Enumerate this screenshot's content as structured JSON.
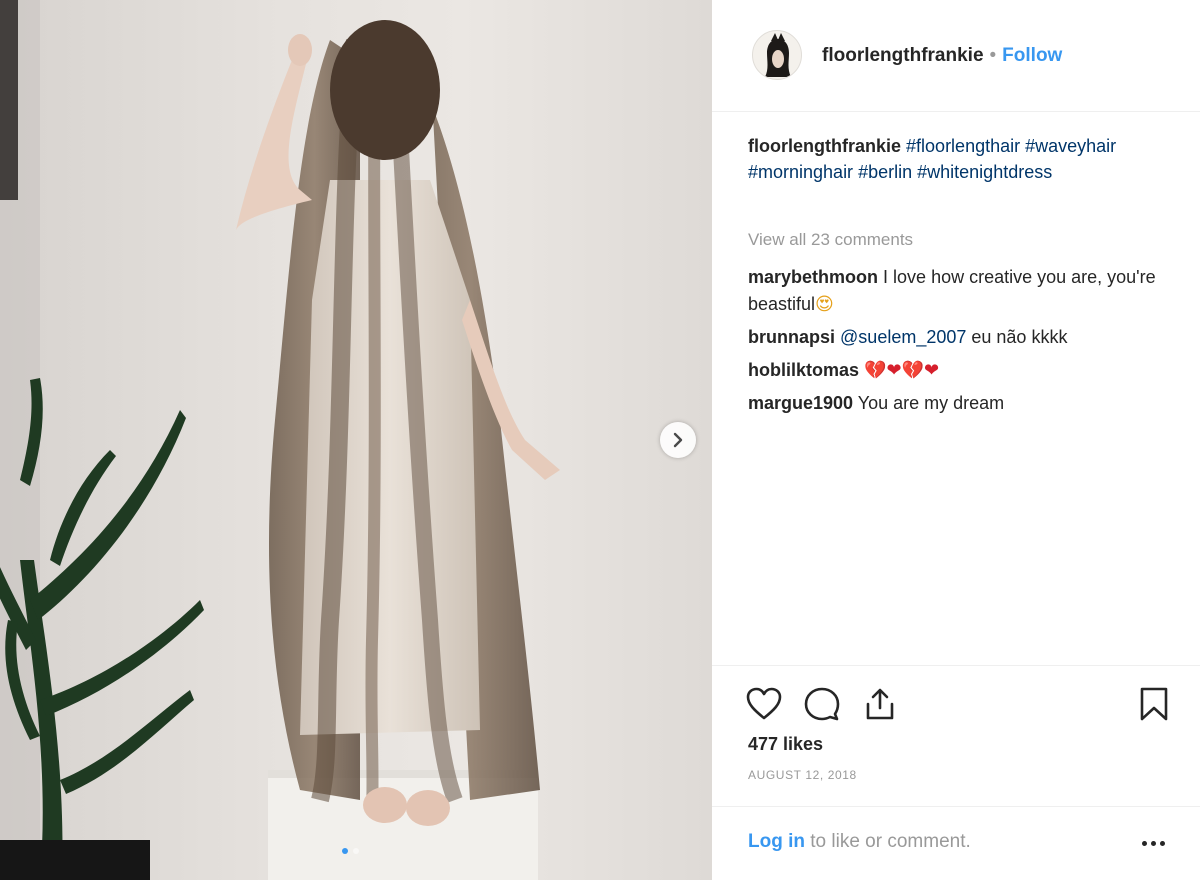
{
  "post": {
    "username": "floorlengthfrankie",
    "separator": "•",
    "follow_label": "Follow"
  },
  "caption": {
    "username": "floorlengthfrankie",
    "hashtags": [
      "#floorlengthair",
      "#waveyhair",
      "#morninghair",
      "#berlin",
      "#whitenightdress"
    ]
  },
  "view_all_label": "View all 23 comments",
  "comments": [
    {
      "user": "marybethmoon",
      "text": "I love how creative you are, you're beastiful",
      "emoji": "😍"
    },
    {
      "user": "brunnapsi",
      "mention": "@suelem_2007",
      "text": " eu não kkkk"
    },
    {
      "user": "hoblilktomas",
      "text": "",
      "emoji": "💔❤💔❤"
    },
    {
      "user": "margue1900",
      "text": "You are my dream"
    }
  ],
  "likes_label": "477 likes",
  "date_label": "AUGUST 12, 2018",
  "footer": {
    "login_label": "Log in",
    "login_suffix": " to like or comment."
  },
  "icons": {
    "like": "heart-icon",
    "comment": "comment-bubble-icon",
    "share": "share-icon",
    "save": "bookmark-icon",
    "more": "more-options-icon",
    "next": "chevron-right-icon"
  },
  "colors": {
    "link_blue": "#3897f0",
    "hashtag_navy": "#003569",
    "muted_gray": "#999999",
    "text": "#262626"
  },
  "carousel": {
    "total": 2,
    "active": 1
  }
}
